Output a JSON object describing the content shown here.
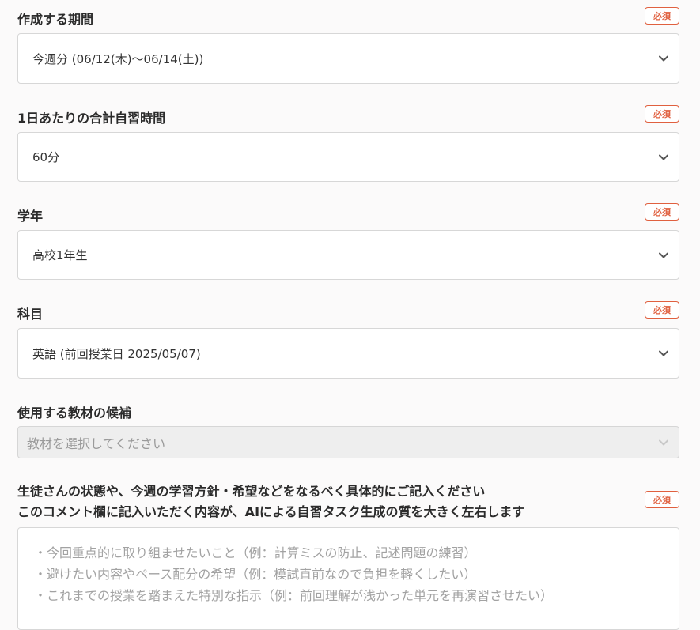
{
  "fields": {
    "period": {
      "label": "作成する期間",
      "required": "必須",
      "value": "今週分 (06/12(木)〜06/14(土))"
    },
    "study_time": {
      "label": "1日あたりの合計自習時間",
      "required": "必須",
      "value": "60分"
    },
    "grade": {
      "label": "学年",
      "required": "必須",
      "value": "高校1年生"
    },
    "subject": {
      "label": "科目",
      "required": "必須",
      "value": "英語 (前回授業日 2025/05/07)"
    },
    "materials": {
      "label": "使用する教材の候補",
      "placeholder": "教材を選択してください"
    },
    "comment": {
      "label_line1": "生徒さんの状態や、今週の学習方針・希望などをなるべく具体的にご記入ください",
      "label_line2": "このコメント欄に記入いただく内容が、AIによる自習タスク生成の質を大きく左右します",
      "required": "必須",
      "placeholder_lines": [
        "・今回重点的に取り組ませたいこと（例：計算ミスの防止、記述問題の練習）",
        "・避けたい内容やペース配分の希望（例：模試直前なので負担を軽くしたい）",
        "・これまでの授業を踏まえた特別な指示（例：前回理解が浅かった単元を再演習させたい）"
      ]
    }
  },
  "icons": {
    "dropdown": "chevron-down-icon"
  },
  "colors": {
    "required_badge": "#e0603f",
    "border": "#d7d7d7",
    "disabled_bg": "#eeeeee"
  }
}
